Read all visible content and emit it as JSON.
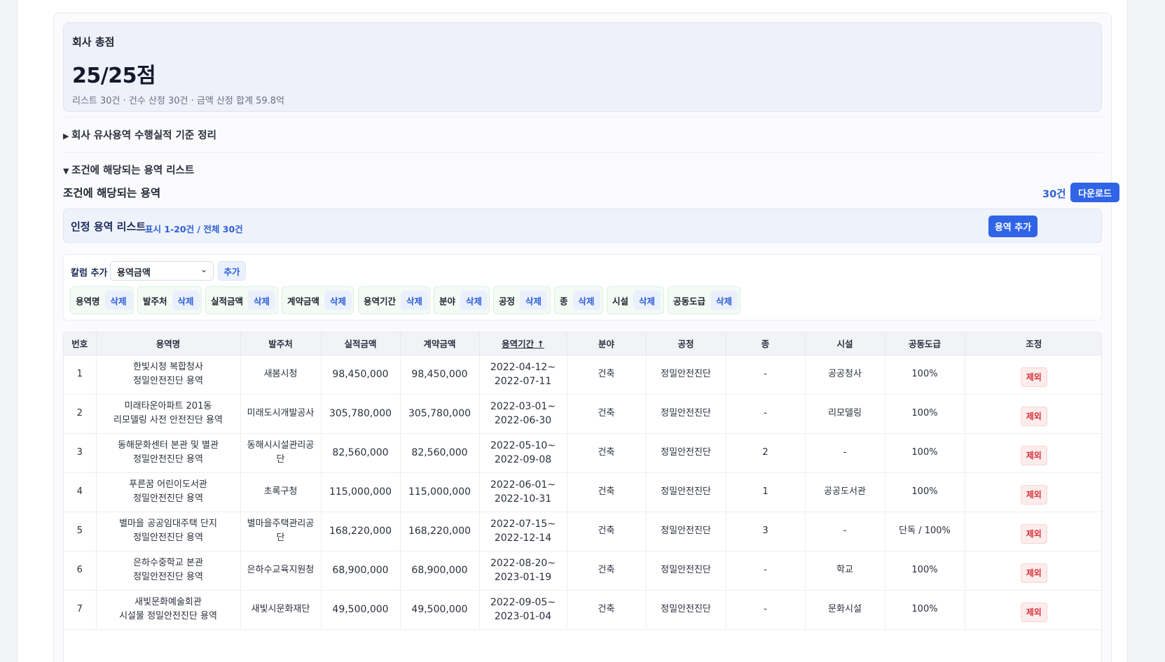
{
  "score": {
    "label": "회사 총점",
    "value": "25/25점",
    "summary": "리스트 30건 · 건수 산정 30건 · 금액 산정 합계 59.8억"
  },
  "sections": {
    "criteria": {
      "marker": "▶",
      "label": "회사 유사용역 수행실적 기준 정리"
    },
    "list": {
      "marker": "▼",
      "label": "조건에 해당되는 용역 리스트"
    }
  },
  "matching": {
    "title": "조건에 해당되는 용역",
    "count": "30건",
    "download_label": "다운로드"
  },
  "approved": {
    "title": "인정 용역 리스트",
    "range": "표시 1-20건 / 전체 30건",
    "add_label": "용역 추가"
  },
  "columns_panel": {
    "add_label": "칼럼 추가",
    "select_value": "용역금액",
    "add_button": "추가",
    "delete_label": "삭제",
    "chips": [
      "용역명",
      "발주처",
      "실적금액",
      "계약금액",
      "용역기간",
      "분야",
      "공정",
      "종",
      "시설",
      "공동도급"
    ]
  },
  "table": {
    "headers": {
      "no": "번호",
      "name": "용역명",
      "client": "발주처",
      "perf": "실적금액",
      "contract": "계약금액",
      "period": "용역기간 ↑",
      "field": "분야",
      "process": "공정",
      "type": "종",
      "facility": "시설",
      "joint": "공동도급",
      "adjust": "조정"
    },
    "exclude_label": "제외",
    "rows": [
      {
        "no": "1",
        "name1": "한빛시청 복합청사",
        "name2": "정밀안전진단 용역",
        "client": "새봄시청",
        "perf": "98,450,000",
        "contract": "98,450,000",
        "p1": "2022-04-12~",
        "p2": "2022-07-11",
        "field": "건축",
        "process": "정밀안전진단",
        "type": "-",
        "facility": "공공청사",
        "joint": "100%"
      },
      {
        "no": "2",
        "name1": "미래타운아파트 201동",
        "name2": "리모델링 사전 안전진단 용역",
        "client": "미래도시개발공사",
        "perf": "305,780,000",
        "contract": "305,780,000",
        "p1": "2022-03-01~",
        "p2": "2022-06-30",
        "field": "건축",
        "process": "정밀안전진단",
        "type": "-",
        "facility": "리모델링",
        "joint": "100%"
      },
      {
        "no": "3",
        "name1": "동해문화센터 본관 및 별관",
        "name2": "정밀안전진단 용역",
        "client": "동해시시설관리공단",
        "perf": "82,560,000",
        "contract": "82,560,000",
        "p1": "2022-05-10~",
        "p2": "2022-09-08",
        "field": "건축",
        "process": "정밀안전진단",
        "type": "2",
        "facility": "-",
        "joint": "100%"
      },
      {
        "no": "4",
        "name1": "푸른꿈 어린이도서관",
        "name2": "정밀안전진단 용역",
        "client": "초록구청",
        "perf": "115,000,000",
        "contract": "115,000,000",
        "p1": "2022-06-01~",
        "p2": "2022-10-31",
        "field": "건축",
        "process": "정밀안전진단",
        "type": "1",
        "facility": "공공도서관",
        "joint": "100%"
      },
      {
        "no": "5",
        "name1": "별마을 공공임대주택 단지",
        "name2": "정밀안전진단 용역",
        "client": "별마을주택관리공단",
        "perf": "168,220,000",
        "contract": "168,220,000",
        "p1": "2022-07-15~",
        "p2": "2022-12-14",
        "field": "건축",
        "process": "정밀안전진단",
        "type": "3",
        "facility": "-",
        "joint": "단독 / 100%"
      },
      {
        "no": "6",
        "name1": "은하수중학교 본관",
        "name2": "정밀안전진단 용역",
        "client": "은하수교육지원청",
        "perf": "68,900,000",
        "contract": "68,900,000",
        "p1": "2022-08-20~",
        "p2": "2023-01-19",
        "field": "건축",
        "process": "정밀안전진단",
        "type": "-",
        "facility": "학교",
        "joint": "100%"
      },
      {
        "no": "7",
        "name1": "새빛문화예술회관",
        "name2": "시설물 정밀안전진단 용역",
        "client": "새빛시문화재단",
        "perf": "49,500,000",
        "contract": "49,500,000",
        "p1": "2022-09-05~",
        "p2": "2023-01-04",
        "field": "건축",
        "process": "정밀안전진단",
        "type": "-",
        "facility": "문화시설",
        "joint": "100%"
      }
    ]
  }
}
